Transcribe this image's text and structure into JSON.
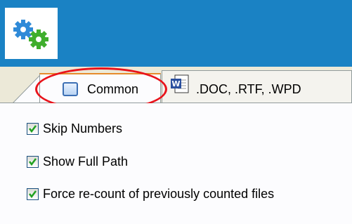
{
  "header": {
    "logo_icon": "gears-icon",
    "background": "#1a82c4"
  },
  "tabs": [
    {
      "label": "Common",
      "icon": "window-icon",
      "selected": true
    },
    {
      "label": ".DOC, .RTF, .WPD",
      "icon": "word-document-icon",
      "selected": false
    }
  ],
  "options": [
    {
      "label": "Skip Numbers",
      "checked": true
    },
    {
      "label": "Show Full Path",
      "checked": true
    },
    {
      "label": "Force re-count of previously counted files",
      "checked": true
    }
  ],
  "highlight_color": "#e8131b"
}
